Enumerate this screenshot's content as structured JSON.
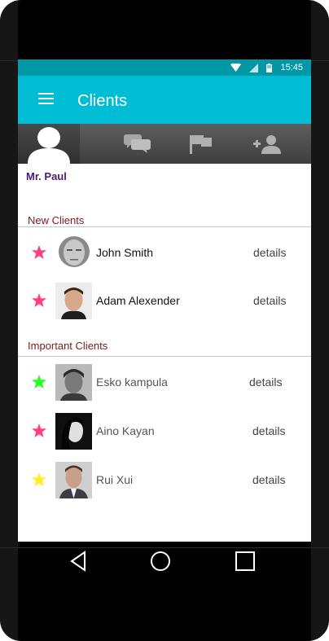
{
  "status_bar": {
    "time": "15:45",
    "icons": [
      "wifi-icon",
      "signal-icon",
      "battery-icon"
    ]
  },
  "app_bar": {
    "title": "Clients",
    "menu_icon": "menu-icon"
  },
  "tabs": [
    {
      "icon": "profile-icon"
    },
    {
      "icon": "messages-icon"
    },
    {
      "icon": "flag-icon"
    },
    {
      "icon": "add-user-icon"
    }
  ],
  "user": {
    "greeting": "Mr. Paul"
  },
  "sections": [
    {
      "header": "New Clients",
      "clients": [
        {
          "name": "John Smith",
          "star_color": "#ff4081",
          "action": "details"
        },
        {
          "name": "Adam Alexender",
          "star_color": "#ff4081",
          "action": "details"
        }
      ]
    },
    {
      "header": "Important Clients",
      "clients": [
        {
          "name": "Esko kampula",
          "star_color": "#22ff22",
          "action": "details"
        },
        {
          "name": "Aino Kayan",
          "star_color": "#ff4081",
          "action": "details"
        },
        {
          "name": "Rui Xui",
          "star_color": "#ffee22",
          "action": "details"
        }
      ]
    }
  ],
  "nav": [
    {
      "icon": "back-icon"
    },
    {
      "icon": "home-icon"
    },
    {
      "icon": "recents-icon"
    }
  ],
  "colors": {
    "status_bar": "#0097a7",
    "app_bar": "#00bcd4",
    "greeting": "#4a1a7a",
    "section_header": "#7a2020"
  }
}
